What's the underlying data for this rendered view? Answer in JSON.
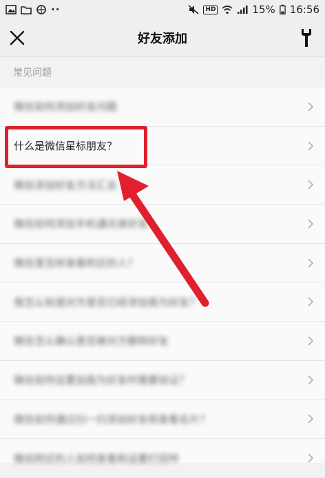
{
  "status_bar": {
    "battery": "15%",
    "time": "16:56",
    "network_badge": "HD"
  },
  "nav": {
    "title": "好友添加",
    "close_icon": "close-icon",
    "tool_icon": "wrench-icon"
  },
  "section": {
    "title": "常见问题"
  },
  "faq": [
    {
      "label": "微信如何添加好友问题",
      "blurred": true
    },
    {
      "label": "什么是微信星标朋友？",
      "blurred": false,
      "highlighted": true
    },
    {
      "label": "微信添加好友方法汇总",
      "blurred": true
    },
    {
      "label": "微信如何添加手机通讯录好友",
      "blurred": true
    },
    {
      "label": "微信里怎样查看附近的人？",
      "blurred": true
    },
    {
      "label": "我怎么知道对方是否已经添加我为好友？",
      "blurred": true
    },
    {
      "label": "微信怎么确认是否被对方删除好友",
      "blurred": true
    },
    {
      "label": "微信如何设置加我为好友时需要验证？",
      "blurred": true
    },
    {
      "label": "微信如何通过扫一扫添加好友和查看名片？",
      "blurred": true
    },
    {
      "label": "微信附近的人如何查看和设置打招呼",
      "blurred": true
    }
  ],
  "colors": {
    "annotation_red": "#e0202e",
    "background": "#f2f2f2"
  }
}
